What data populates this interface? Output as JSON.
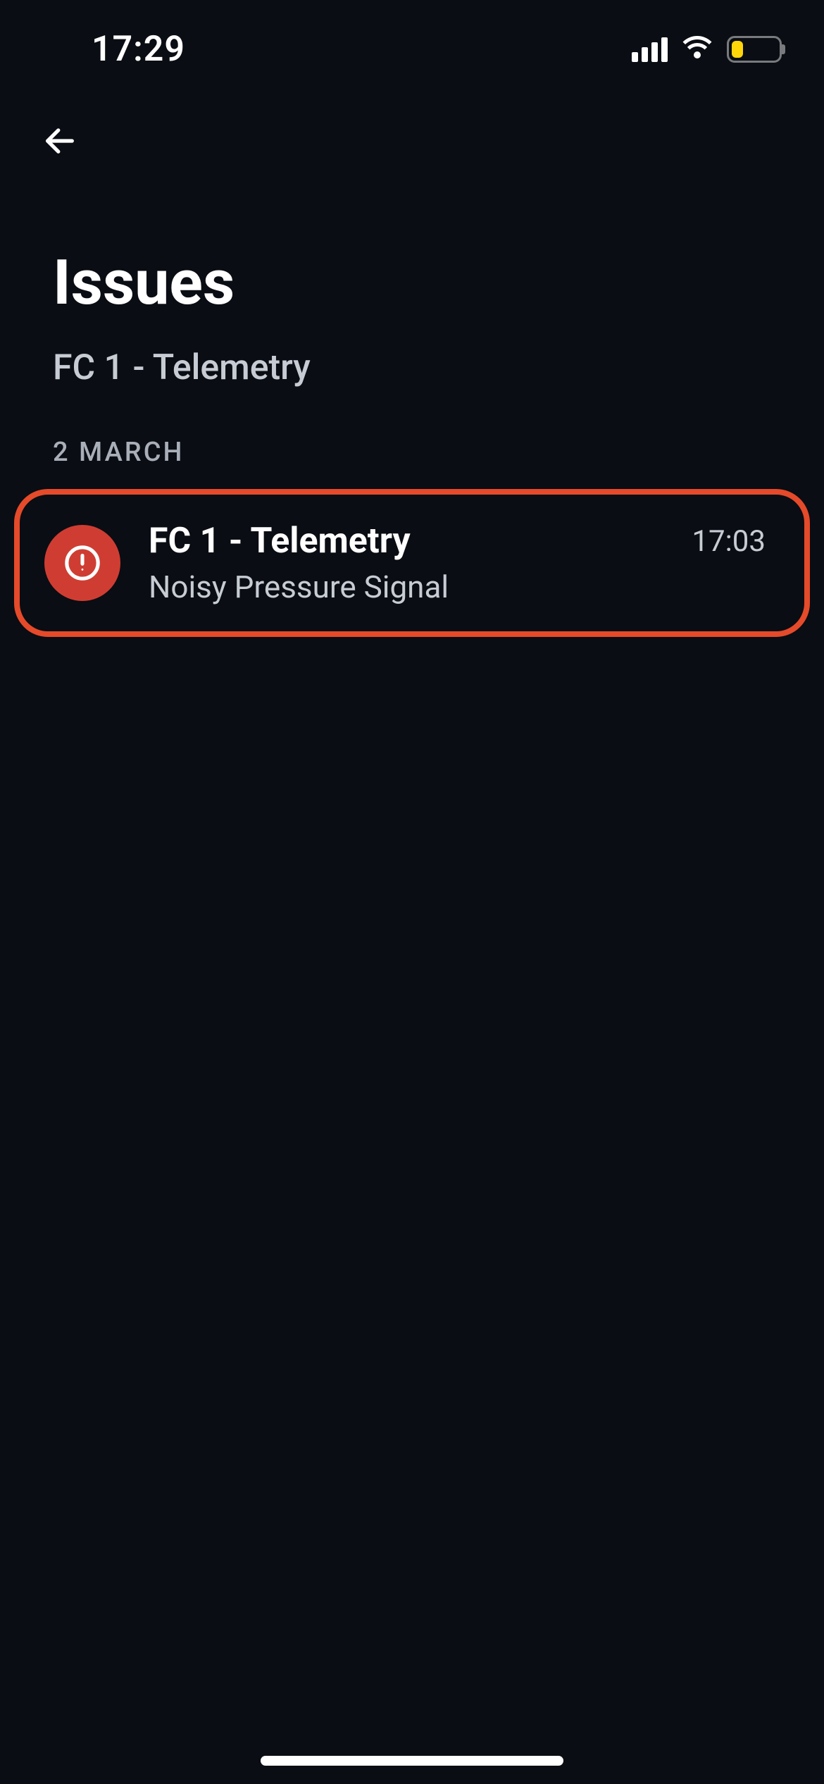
{
  "status": {
    "time": "17:29"
  },
  "colors": {
    "accent": "#e54a2a",
    "alert": "#cf3d32",
    "batteryLevel": "#ffd60a"
  },
  "header": {
    "title": "Issues",
    "subtitle": "FC 1 - Telemetry"
  },
  "sections": [
    {
      "label": "2 MARCH",
      "items": [
        {
          "title": "FC 1 - Telemetry",
          "description": "Noisy Pressure Signal",
          "time": "17:03",
          "severity": "alert",
          "highlighted": true
        }
      ]
    }
  ]
}
